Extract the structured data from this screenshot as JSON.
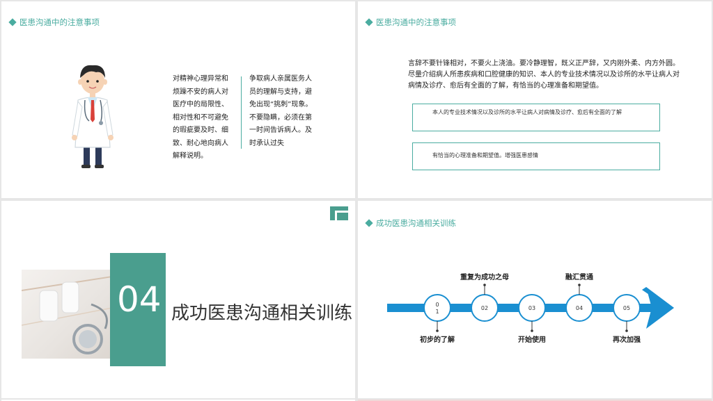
{
  "slide1": {
    "title": "医患沟通中的注意事项",
    "column1": "对精神心理异常和烦躁不安的病人对医疗中的局限性、相对性和不可避免的瑕疵要及时、细致、耐心地向病人解释说明。",
    "column2": "争取病人亲属医务人员的理解与支持，避免出现“挑刺”现象。不要隐瞒，必须在第一时间告诉病人。及时承认过失"
  },
  "slide2": {
    "title": "医患沟通中的注意事项",
    "paragraph": "言辞不要针锋相对，不要火上浇油。要冷静理智，既义正严辞，又内刚外柔、内方外圆。尽量介绍病人所患疾病和口腔健康的知识、本人的专业技术情况以及诊所的水平让病人对病情及诊疗、愈后有全面的了解，有恰当的心理准备和期望值。",
    "box1": "本人的专业技术情况以及诊所的水平让病人对病情及诊疗、愈后有全面的了解",
    "box2": "有恰当的心理准备和期望值。增强医患感情"
  },
  "slide3": {
    "number": "04",
    "title": "成功医患沟通相关训练"
  },
  "slide4": {
    "title": "成功医患沟通相关训练",
    "steps": [
      {
        "num": "0\n1",
        "label": "初步的了解",
        "pos": "below"
      },
      {
        "num": "02",
        "label": "重复为成功之母",
        "pos": "above"
      },
      {
        "num": "03",
        "label": "开始使用",
        "pos": "below"
      },
      {
        "num": "04",
        "label": "融汇贯通",
        "pos": "above"
      },
      {
        "num": "05",
        "label": "再次加强",
        "pos": "below"
      }
    ]
  },
  "colors": {
    "teal": "#4aaca0",
    "tealDark": "#4a9e8e",
    "arrow": "#1a8fd1"
  },
  "icons": {
    "doctor": "doctor-illustration",
    "corner": "corner-bracket-icon",
    "photo": "medical-tools-photo"
  }
}
